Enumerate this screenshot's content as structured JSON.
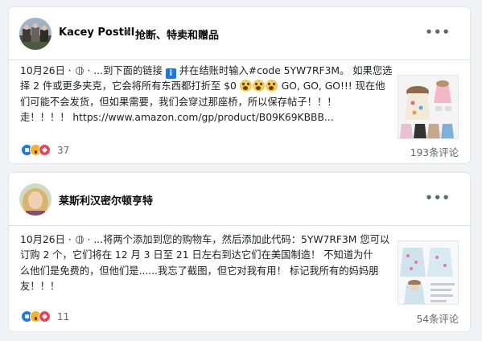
{
  "posts": [
    {
      "author": "Kacey Postill",
      "group": "抢断、特卖和赠品",
      "more_label": "•••",
      "date": "10月26日",
      "lines": [
        [
          "...到下面的链接",
          "并在结账时输入#code 5YW7RF3M。 如果您选"
        ],
        [
          "择 2 件或更多夹克，它会将所有东西都打折至 $0",
          "GO, GO, GO!!! 现在他"
        ],
        [
          "们可能不会发货，但如果需要，我们会穿过那座桥，所以保存帖子！！！"
        ],
        [
          "走！！！！ https://www.amazon.com/gp/product/B09K69KBBB..."
        ]
      ],
      "info_icon": "info-icon",
      "reaction_count": "37",
      "comments": "193条评论"
    },
    {
      "author": "莱斯利汉密尔顿亨特",
      "more_label": "•••",
      "date": "10月26日",
      "lines": [
        [
          "...将两个添加到您的购物车，然后添加此代码：5YW7RF3M 您可以"
        ],
        [
          "订购 2 个，它们将在 12 月 3 日至 21 日左右到达它们在美国制造！ 不知道为什"
        ],
        [
          "么他们是免费的，但他们是......我忘了截图，但它对我有用！ 标记我所有的妈妈朋"
        ],
        [
          "友！！！"
        ]
      ],
      "reaction_count": "11",
      "comments": "54条评论"
    }
  ],
  "colors": {
    "link_blue": "#1877f2",
    "muted": "#65676b",
    "background": "#f0f2f5"
  }
}
